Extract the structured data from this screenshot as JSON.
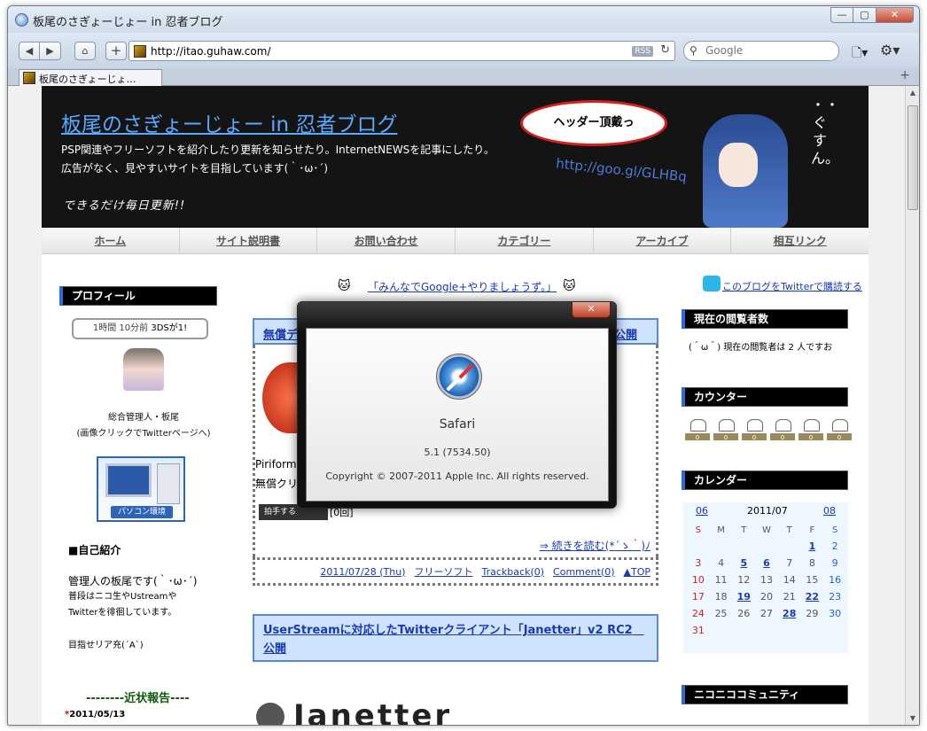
{
  "window": {
    "title": "板尾のさぎょーじょー in 忍者ブログ",
    "controls": [
      "—",
      "▢",
      "✕"
    ]
  },
  "toolbar": {
    "url": "http://itao.guhaw.com/",
    "rss_label": "RSS",
    "search_placeholder": "Google"
  },
  "tabs": [
    {
      "label": "板尾のさぎょーじょ…"
    }
  ],
  "header": {
    "title": "板尾のさぎょーじょー in 忍者ブログ",
    "desc_line1": "PSP関連やフリーソフトを紹介したり更新を知らせたり。InternetNEWSを記事にしたり。",
    "desc_line2": "広告がなく、見やすいサイトを目指しています(｀･ω･´)",
    "tagline": "できるだけ毎日更新!!",
    "bubble": "ヘッダー頂戴っ",
    "short_url": "http://goo.gl/GLHBq",
    "vertical_text": "・・ぐすん。"
  },
  "nav": [
    "ホーム",
    "サイト説明書",
    "お問い合わせ",
    "カテゴリー",
    "アーカイブ",
    "相互リンク"
  ],
  "left": {
    "profile_heading": "プロフィール",
    "tweet_time": "1時間 10分前",
    "tweet_text": "3DSが1!",
    "admin_line1": "総合管理人・板尾",
    "admin_line2": "(画像クリックでTwitterページへ)",
    "pc_banner_label": "パソコン環境",
    "self_intro_heading": "■自己紹介",
    "self_intro_line1": "管理人の板尾です(｀･ω･´)",
    "self_intro_line2": "普段はニコ生やUstreamや",
    "self_intro_line3": "Twitterを徘徊しています。",
    "self_intro_line4": "目指せリア充(´A`)",
    "recent_heading": "--------近状報告----",
    "recent_date": "2011/05/13"
  },
  "center": {
    "google_promo": "「みんなでGoogle+やりましょうず。」",
    "post1_title_left": "無償デ",
    "post1_title_right": "公開",
    "post1_line1": "Piriform L",
    "post1_line2": "無償クリー",
    "clap_label": "拍手する",
    "clap_count": "[0回]",
    "read_more": "⇒ 続きを読む(*´ゝ｀)ﾉ",
    "post_meta": {
      "date": "2011/07/28 (Thu)",
      "category": "フリーソフト",
      "trackback": "Trackback(0)",
      "comment": "Comment(0)",
      "top": "▲TOP"
    },
    "post2_title": "UserStreamに対応したTwitterクライアント「Janetter」v2 RC2　公開",
    "janetter_logo": "Janetter"
  },
  "right": {
    "twitter_link": "このブログをTwitterで購読する",
    "viewers_heading": "現在の閲覧者数",
    "viewers_text": "(＾ω＾) 現在の閲覧者は 2 人ですお",
    "counter_heading": "カウンター",
    "counter_digits": [
      "0",
      "0",
      "0",
      "0",
      "0",
      "0"
    ],
    "calendar_heading": "カレンダー",
    "niconico_heading": "ニコニココミュニティ"
  },
  "calendar": {
    "prev": "06",
    "month": "2011/07",
    "next": "08",
    "days_of_week": [
      "S",
      "M",
      "T",
      "W",
      "T",
      "F",
      "S"
    ],
    "rows": [
      [
        "",
        "",
        "",
        "",
        "",
        "1",
        "2"
      ],
      [
        "3",
        "4",
        "5",
        "6",
        "7",
        "8",
        "9"
      ],
      [
        "10",
        "11",
        "12",
        "13",
        "14",
        "15",
        "16"
      ],
      [
        "17",
        "18",
        "19",
        "20",
        "21",
        "22",
        "23"
      ],
      [
        "24",
        "25",
        "26",
        "27",
        "28",
        "29",
        "30"
      ],
      [
        "31",
        "",
        "",
        "",
        "",
        "",
        ""
      ]
    ],
    "linked_days": [
      "1",
      "5",
      "6",
      "19",
      "22",
      "28"
    ]
  },
  "dialog": {
    "close": "✕",
    "app_name": "Safari",
    "version": "5.1 (7534.50)",
    "copyright": "Copyright © 2007-2011 Apple Inc. All rights reserved."
  }
}
